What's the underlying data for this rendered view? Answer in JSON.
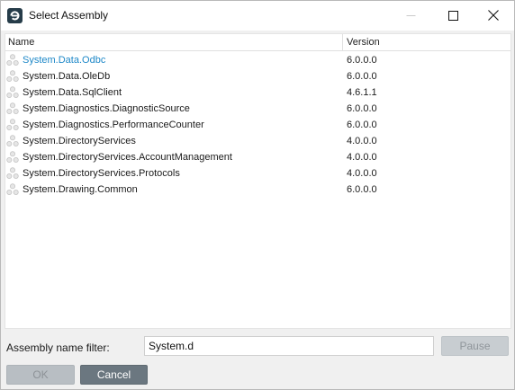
{
  "window": {
    "title": "Select Assembly",
    "app_icon": "app-logo-icon",
    "controls": [
      "minimize-icon",
      "maximize-icon",
      "close-icon"
    ]
  },
  "list": {
    "columns": {
      "name": "Name",
      "version": "Version"
    },
    "rows": [
      {
        "name": "System.Data.Odbc",
        "version": "6.0.0.0",
        "selected": true
      },
      {
        "name": "System.Data.OleDb",
        "version": "6.0.0.0",
        "selected": false
      },
      {
        "name": "System.Data.SqlClient",
        "version": "4.6.1.1",
        "selected": false
      },
      {
        "name": "System.Diagnostics.DiagnosticSource",
        "version": "6.0.0.0",
        "selected": false
      },
      {
        "name": "System.Diagnostics.PerformanceCounter",
        "version": "6.0.0.0",
        "selected": false
      },
      {
        "name": "System.DirectoryServices",
        "version": "4.0.0.0",
        "selected": false
      },
      {
        "name": "System.DirectoryServices.AccountManagement",
        "version": "4.0.0.0",
        "selected": false
      },
      {
        "name": "System.DirectoryServices.Protocols",
        "version": "4.0.0.0",
        "selected": false
      },
      {
        "name": "System.Drawing.Common",
        "version": "6.0.0.0",
        "selected": false
      }
    ],
    "row_icon": "assembly-icon"
  },
  "filter": {
    "label": "Assembly name filter:",
    "value": "System.d"
  },
  "buttons": {
    "pause": "Pause",
    "ok": "OK",
    "cancel": "Cancel"
  },
  "colors": {
    "selected_text": "#1e88c8",
    "cancel_button": "#6b7780",
    "disabled_button": "#b8bec3",
    "app_icon_bg": "#263c49"
  }
}
